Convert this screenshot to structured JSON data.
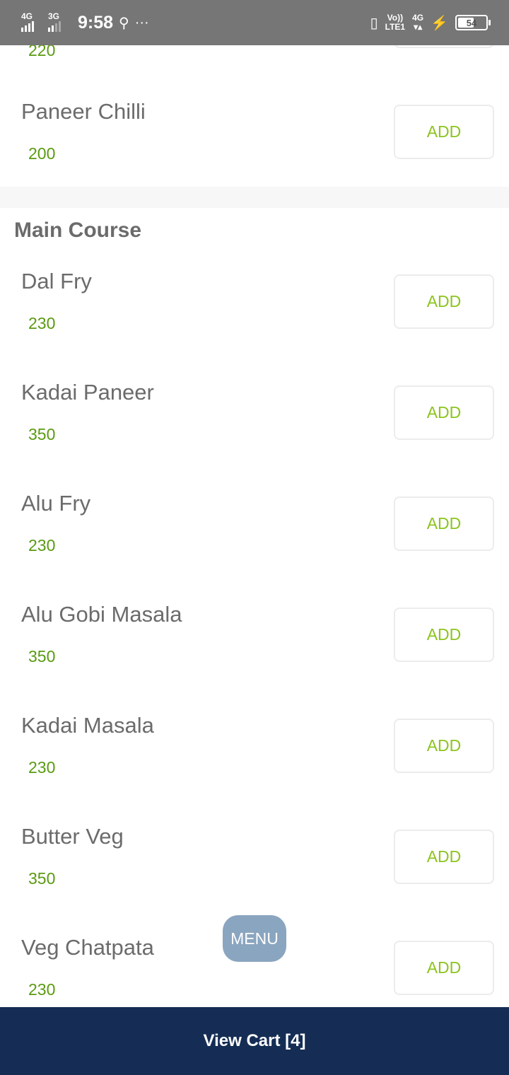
{
  "status_bar": {
    "network1": "4G",
    "network2": "3G",
    "time": "9:58",
    "usb_icon": "usb-icon",
    "more": "···",
    "volte": "Vo))",
    "lte": "LTE1",
    "network3": "4G",
    "battery": "54"
  },
  "menu": {
    "partial_top_price": "220",
    "top_items": [
      {
        "name": "Paneer Chilli",
        "price": "200",
        "add": "ADD"
      }
    ],
    "section_title": "Main Course",
    "items": [
      {
        "name": "Dal Fry",
        "price": "230",
        "add": "ADD"
      },
      {
        "name": "Kadai Paneer",
        "price": "350",
        "add": "ADD"
      },
      {
        "name": "Alu Fry",
        "price": "230",
        "add": "ADD"
      },
      {
        "name": "Alu Gobi Masala",
        "price": "350",
        "add": "ADD"
      },
      {
        "name": "Kadai Masala",
        "price": "230",
        "add": "ADD"
      },
      {
        "name": "Butter Veg",
        "price": "350",
        "add": "ADD"
      },
      {
        "name": "Veg Chatpata",
        "price": "230",
        "add": "ADD"
      }
    ]
  },
  "menu_fab": "MENU",
  "cart": {
    "label": "View Cart [4]"
  },
  "colors": {
    "price": "#5a9a10",
    "add": "#8cc41d",
    "cart_bar": "#152d54",
    "fab": "#8aa5bf"
  }
}
